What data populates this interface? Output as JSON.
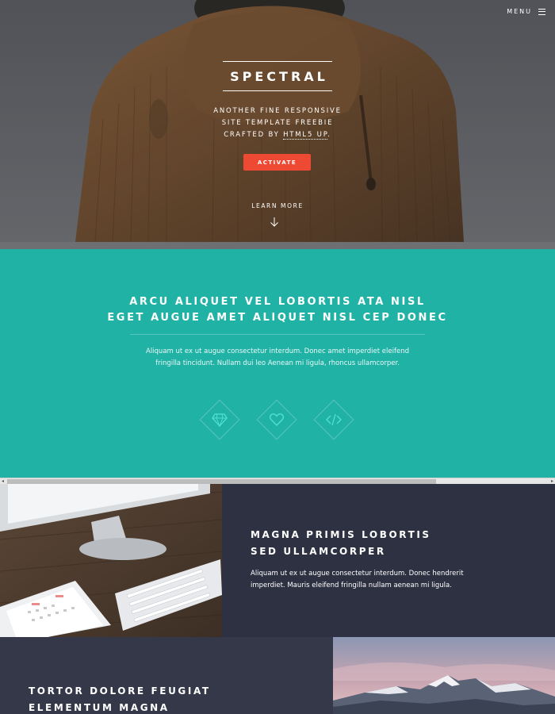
{
  "header": {
    "menu_label": "MENU"
  },
  "banner": {
    "title": "SPECTRAL",
    "tagline_line1": "ANOTHER FINE RESPONSIVE",
    "tagline_line2": "SITE TEMPLATE FREEBIE",
    "tagline_line3_prefix": "CRAFTED BY ",
    "tagline_link": "HTML5 UP",
    "tagline_suffix": ".",
    "activate_label": "ACTIVATE",
    "learn_more_label": "LEARN MORE"
  },
  "one": {
    "heading_line1": "ARCU ALIQUET VEL LOBORTIS ATA NISL",
    "heading_line2": "EGET AUGUE AMET ALIQUET NISL CEP DONEC",
    "text_line1": "Aliquam ut ex ut augue consectetur interdum. Donec amet imperdiet eleifend",
    "text_line2": "fringilla tincidunt. Nullam dui leo Aenean mi ligula, rhoncus ullamcorper.",
    "icons": [
      "diamond-icon",
      "heart-icon",
      "code-icon"
    ]
  },
  "spotlight1": {
    "heading_line1": "MAGNA PRIMIS LOBORTIS",
    "heading_line2": "SED ULLAMCORPER",
    "text_line1": "Aliquam ut ex ut augue consectetur interdum. Donec hendrerit",
    "text_line2": "imperdiet. Mauris eleifend fringilla nullam aenean mi ligula."
  },
  "spotlight2": {
    "heading_line1": "TORTOR DOLORE FEUGIAT",
    "heading_line2": "ELEMENTUM MAGNA"
  },
  "colors": {
    "accent_red": "#ed4933",
    "teal": "#21b2a6",
    "dark": "#2e3141",
    "icon_teal": "#4fe0d4"
  }
}
